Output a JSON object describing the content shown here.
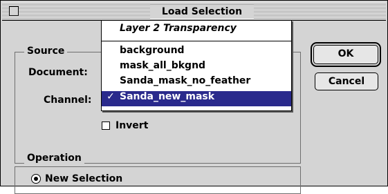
{
  "dialog": {
    "title": "Load Selection",
    "ok_label": "OK",
    "cancel_label": "Cancel"
  },
  "source": {
    "group_label": "Source",
    "document_label": "Document:",
    "channel_label": "Channel:",
    "invert_label": "Invert",
    "invert_checked": false
  },
  "channel_menu": {
    "items": [
      {
        "label": "Layer 2 Transparency",
        "italic": true,
        "selected": false
      },
      {
        "label": "background",
        "italic": false,
        "selected": false
      },
      {
        "label": "mask_all_bkgnd",
        "italic": false,
        "selected": false
      },
      {
        "label": "Sanda_mask_no_feather",
        "italic": false,
        "selected": false
      },
      {
        "label": "Sanda_new_mask",
        "italic": false,
        "selected": true
      }
    ],
    "check_mark": "✓",
    "highlight_color": "#2a2a8c"
  },
  "operation": {
    "group_label": "Operation",
    "new_selection_label": "New Selection",
    "new_selection_checked": true
  }
}
